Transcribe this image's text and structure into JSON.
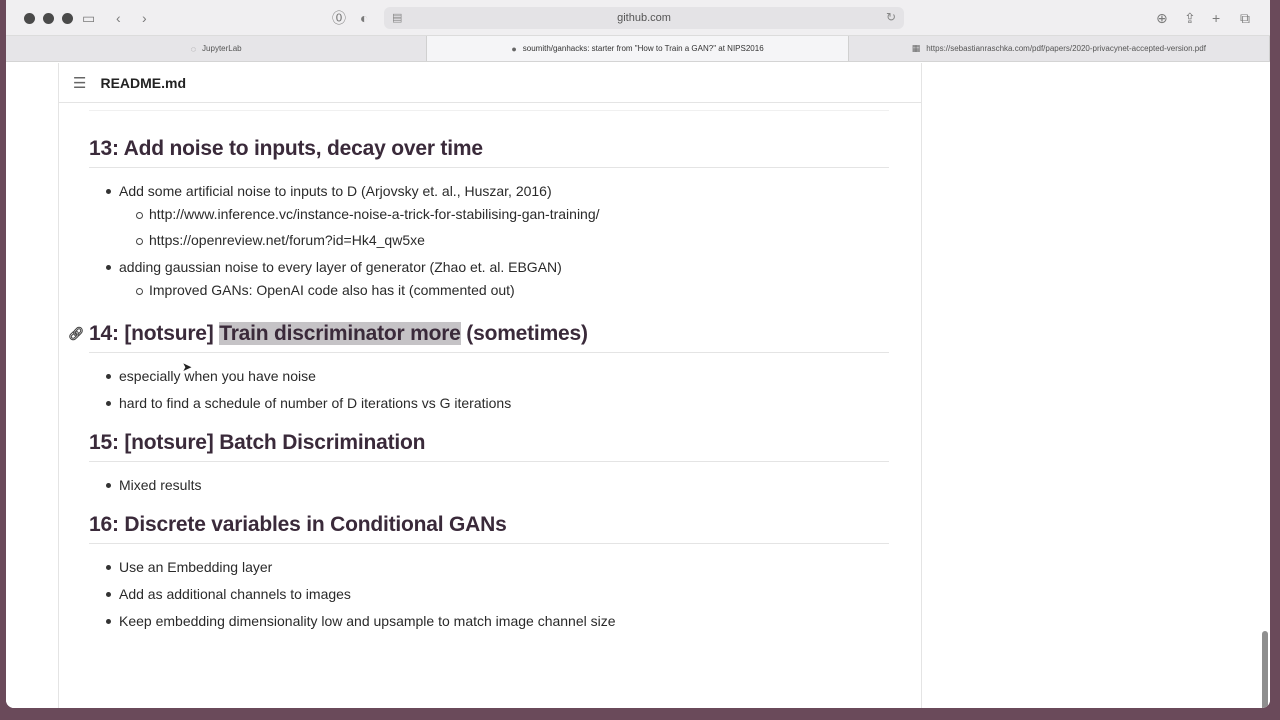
{
  "browser": {
    "url": "github.com"
  },
  "tabs": [
    {
      "label": "JupyterLab",
      "icon": "spinner-icon"
    },
    {
      "label": "soumith/ganhacks: starter from \"How to Train a GAN?\" at NIPS2016",
      "icon": "github-icon"
    },
    {
      "label": "https://sebastianraschka.com/pdf/papers/2020-privacynet-accepted-version.pdf",
      "icon": "pdf-icon"
    }
  ],
  "readme": {
    "title": "README.md"
  },
  "sections": [
    {
      "heading": "13: Add noise to inputs, decay over time",
      "items": [
        {
          "text": "Add some artificial noise to inputs to D (Arjovsky et. al., Huszar, 2016)",
          "sub": [
            "http://www.inference.vc/instance-noise-a-trick-for-stabilising-gan-training/",
            "https://openreview.net/forum?id=Hk4_qw5xe"
          ]
        },
        {
          "text": "adding gaussian noise to every layer of generator (Zhao et. al. EBGAN)",
          "sub": [
            "Improved GANs: OpenAI code also has it (commented out)"
          ]
        }
      ]
    },
    {
      "heading_pre": "14: [notsure] ",
      "heading_hl": "Train discriminator more",
      "heading_post": " (sometimes)",
      "items": [
        {
          "text": "especially when you have noise"
        },
        {
          "text": "hard to find a schedule of number of D iterations vs G iterations"
        }
      ]
    },
    {
      "heading": "15: [notsure] Batch Discrimination",
      "items": [
        {
          "text": "Mixed results"
        }
      ]
    },
    {
      "heading": "16: Discrete variables in Conditional GANs",
      "items": [
        {
          "text": "Use an Embedding layer"
        },
        {
          "text": "Add as additional channels to images"
        },
        {
          "text": "Keep embedding dimensionality low and upsample to match image channel size"
        }
      ]
    }
  ]
}
